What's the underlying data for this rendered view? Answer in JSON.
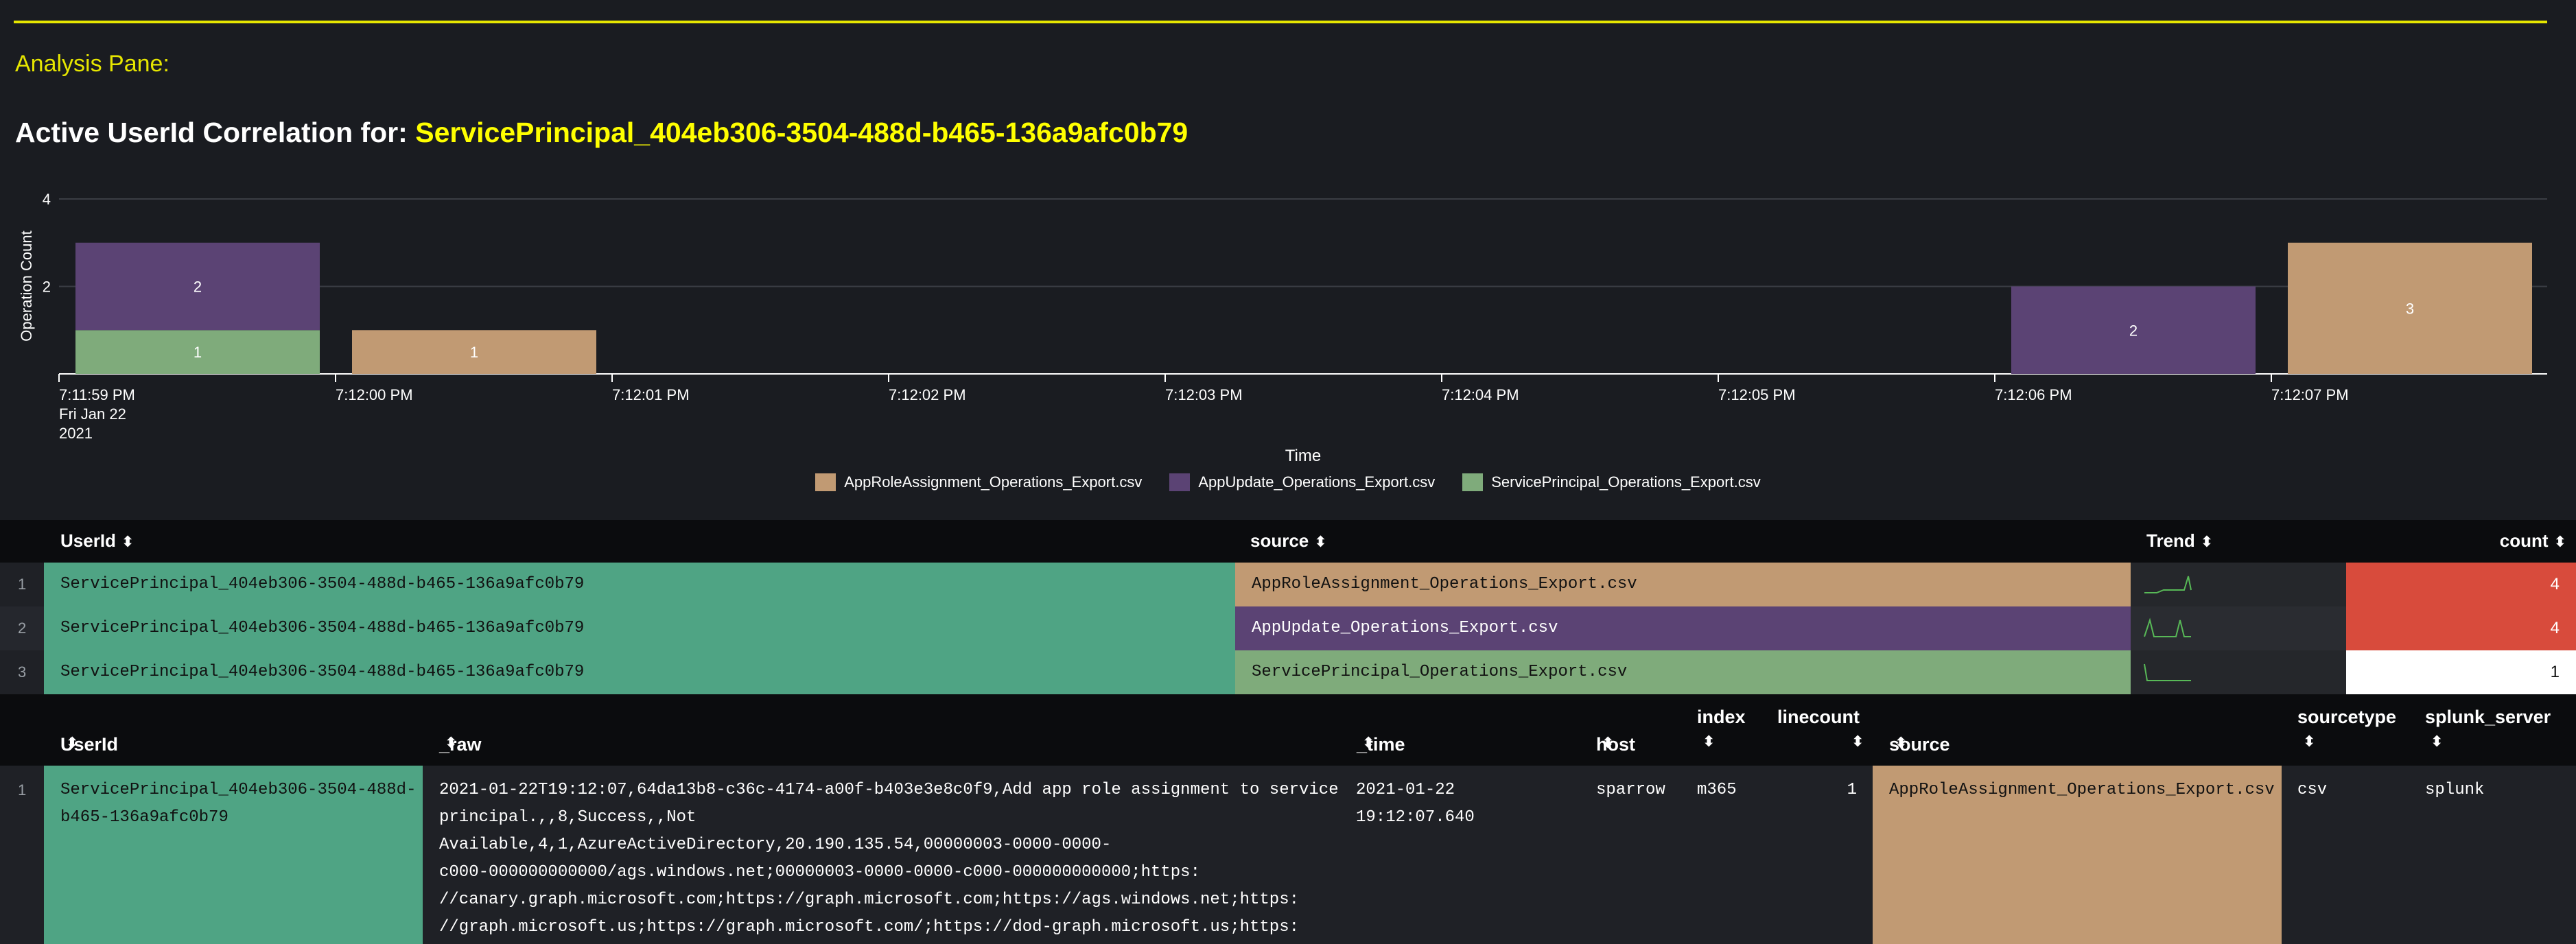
{
  "analysis_pane": {
    "label": "Analysis Pane:"
  },
  "panel": {
    "title_prefix": "Active UserId Correlation for: ",
    "title_value": "ServicePrincipal_404eb306-3504-488d-b465-136a9afc0b79"
  },
  "colors": {
    "accent": "#e6e600",
    "approle": "#c19a73",
    "appupdate": "#5b4374",
    "serviceprincipal": "#7fab7b",
    "userid_cell": "#4fa484",
    "count_high": "#d84b3c",
    "count_low": "#ffffff"
  },
  "chart_data": {
    "type": "bar",
    "stacked": true,
    "xlabel": "Time",
    "ylabel": "Operation Count",
    "ylim": [
      0,
      4
    ],
    "yticks": [
      "2",
      "4"
    ],
    "categories": [
      "7:11:59 PM",
      "7:12:00 PM",
      "7:12:01 PM",
      "7:12:02 PM",
      "7:12:03 PM",
      "7:12:04 PM",
      "7:12:05 PM",
      "7:12:06 PM",
      "7:12:07 PM"
    ],
    "first_tick_extra": [
      "Fri Jan 22",
      "2021"
    ],
    "series": [
      {
        "name": "ServicePrincipal_Operations_Export.csv",
        "values": [
          1,
          0,
          0,
          0,
          0,
          0,
          0,
          0,
          0
        ]
      },
      {
        "name": "AppUpdate_Operations_Export.csv",
        "values": [
          2,
          0,
          0,
          0,
          0,
          0,
          0,
          2,
          0
        ]
      },
      {
        "name": "AppRoleAssignment_Operations_Export.csv",
        "values": [
          0,
          1,
          0,
          0,
          0,
          0,
          0,
          0,
          3
        ]
      }
    ],
    "legend": [
      "AppRoleAssignment_Operations_Export.csv",
      "AppUpdate_Operations_Export.csv",
      "ServicePrincipal_Operations_Export.csv"
    ],
    "legend_position": "bottom",
    "grid": true
  },
  "table1": {
    "headers": {
      "userid": "UserId",
      "source": "source",
      "trend": "Trend",
      "count": "count"
    },
    "sort_icon": "⬍",
    "rows": [
      {
        "num": "1",
        "userid": "ServicePrincipal_404eb306-3504-488d-b465-136a9afc0b79",
        "source": "AppRoleAssignment_Operations_Export.csv",
        "count": "4"
      },
      {
        "num": "2",
        "userid": "ServicePrincipal_404eb306-3504-488d-b465-136a9afc0b79",
        "source": "AppUpdate_Operations_Export.csv",
        "count": "4"
      },
      {
        "num": "3",
        "userid": "ServicePrincipal_404eb306-3504-488d-b465-136a9afc0b79",
        "source": "ServicePrincipal_Operations_Export.csv",
        "count": "1"
      }
    ]
  },
  "table2": {
    "headers": {
      "userid": "UserId",
      "raw": "_raw",
      "time": "_time",
      "host": "host",
      "index": "index",
      "linecount": "linecount",
      "source": "source",
      "sourcetype": "sourcetype",
      "splunk_server": "splunk_server"
    },
    "row": {
      "num": "1",
      "userid_l1": "ServicePrincipal_404eb306-3504-488d-",
      "userid_l2": "b465-136a9afc0b79",
      "raw_lines": [
        "2021-01-22T19:12:07,64da13b8-c36c-4174-a00f-b403e3e8c0f9,Add app role assignment to service",
        "principal.,,8,Success,,Not",
        "Available,4,1,AzureActiveDirectory,20.190.135.54,00000003-0000-0000-",
        "c000-000000000000/ags.windows.net;00000003-0000-0000-c000-000000000000;https:",
        "//canary.graph.microsoft.com;https://graph.microsoft.com;https://ags.windows.net;https:",
        "//graph.microsoft.us;https://graph.microsoft.com/;https://dod-graph.microsoft.us;https:"
      ],
      "time_l1": "2021-01-22",
      "time_l2": "19:12:07.640",
      "host": "sparrow",
      "index": "m365",
      "linecount": "1",
      "source": "AppRoleAssignment_Operations_Export.csv",
      "sourcetype": "csv",
      "splunk_server": "splunk"
    }
  }
}
